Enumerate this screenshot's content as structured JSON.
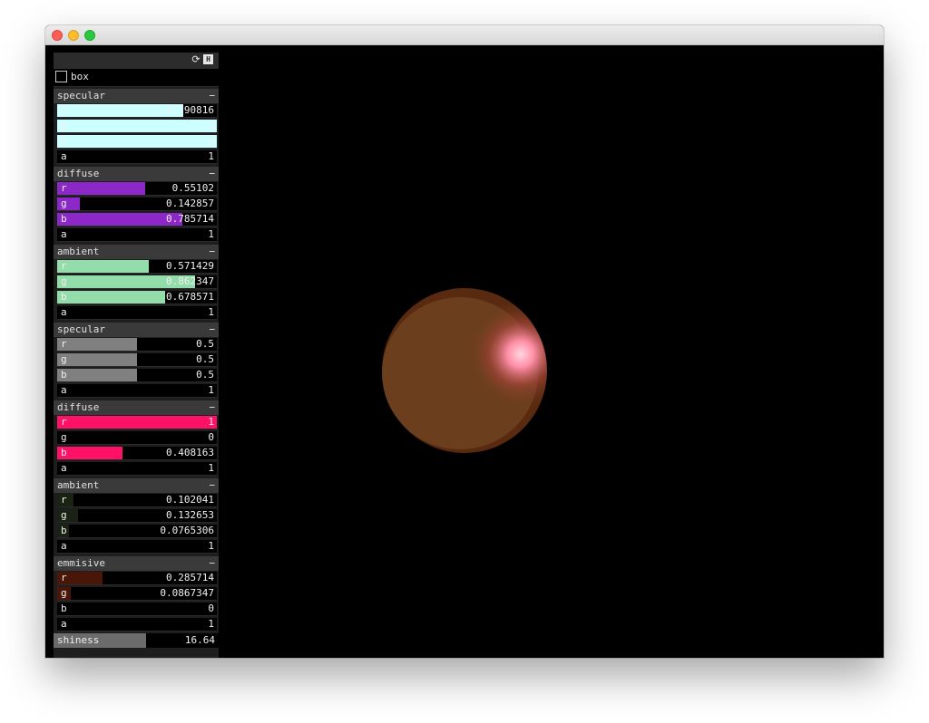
{
  "window": {
    "title": ""
  },
  "panel": {
    "icons": [
      "refresh-icon",
      "save-icon"
    ],
    "toggle": {
      "label": "box",
      "checked": false
    },
    "groups": [
      {
        "title": "specular",
        "collapse": "−",
        "color": "#ccffff",
        "channels": [
          {
            "name": "r",
            "value": "0.790816",
            "fraction": 0.790816
          },
          {
            "name": "g",
            "value": "1",
            "fraction": 1
          },
          {
            "name": "b",
            "value": "1",
            "fraction": 1
          },
          {
            "name": "a",
            "value": "1",
            "fraction": 0
          }
        ]
      },
      {
        "title": "diffuse",
        "collapse": "−",
        "color": "#8b28c7",
        "channels": [
          {
            "name": "r",
            "value": "0.55102",
            "fraction": 0.55102
          },
          {
            "name": "g",
            "value": "0.142857",
            "fraction": 0.142857
          },
          {
            "name": "b",
            "value": "0.785714",
            "fraction": 0.785714
          },
          {
            "name": "a",
            "value": "1",
            "fraction": 0
          }
        ]
      },
      {
        "title": "ambient",
        "collapse": "−",
        "color": "#92ddaa",
        "channels": [
          {
            "name": "r",
            "value": "0.571429",
            "fraction": 0.571429
          },
          {
            "name": "g",
            "value": "0.862347",
            "fraction": 0.862347
          },
          {
            "name": "b",
            "value": "0.678571",
            "fraction": 0.678571
          },
          {
            "name": "a",
            "value": "1",
            "fraction": 0
          }
        ]
      },
      {
        "title": "specular",
        "collapse": "−",
        "color": "#808080",
        "channels": [
          {
            "name": "r",
            "value": "0.5",
            "fraction": 0.5
          },
          {
            "name": "g",
            "value": "0.5",
            "fraction": 0.5
          },
          {
            "name": "b",
            "value": "0.5",
            "fraction": 0.5
          },
          {
            "name": "a",
            "value": "1",
            "fraction": 0
          }
        ]
      },
      {
        "title": "diffuse",
        "collapse": "−",
        "color": "#ff1168",
        "channels": [
          {
            "name": "r",
            "value": "1",
            "fraction": 1
          },
          {
            "name": "g",
            "value": "0",
            "fraction": 0
          },
          {
            "name": "b",
            "value": "0.408163",
            "fraction": 0.408163
          },
          {
            "name": "a",
            "value": "1",
            "fraction": 0
          }
        ]
      },
      {
        "title": "ambient",
        "collapse": "−",
        "color": "#1a2214",
        "channels": [
          {
            "name": "r",
            "value": "0.102041",
            "fraction": 0.102041
          },
          {
            "name": "g",
            "value": "0.132653",
            "fraction": 0.132653
          },
          {
            "name": "b",
            "value": "0.0765306",
            "fraction": 0.0765306
          },
          {
            "name": "a",
            "value": "1",
            "fraction": 0
          }
        ]
      },
      {
        "title": "emmisive",
        "collapse": "−",
        "color": "#491608",
        "channels": [
          {
            "name": "r",
            "value": "0.285714",
            "fraction": 0.285714
          },
          {
            "name": "g",
            "value": "0.0867347",
            "fraction": 0.0867347
          },
          {
            "name": "b",
            "value": "0",
            "fraction": 0
          },
          {
            "name": "a",
            "value": "1",
            "fraction": 0
          }
        ]
      }
    ],
    "shininess": {
      "label": "shiness",
      "value": "16.64",
      "fraction": 0.56
    }
  },
  "scene": {
    "sphere_color": "#6b3e1e",
    "rim_color": "#5a2a10",
    "highlight_color": "#ff9fb0"
  }
}
